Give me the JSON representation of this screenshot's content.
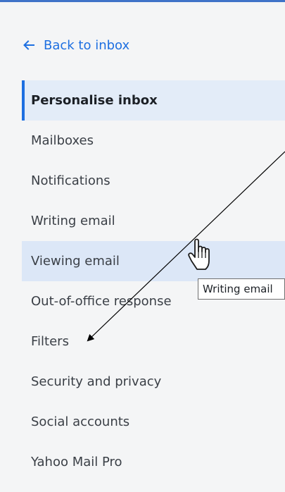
{
  "back_link": {
    "label": "Back to inbox",
    "icon": "left-arrow-icon"
  },
  "menu": {
    "items": [
      {
        "label": "Personalise inbox",
        "state": "selected"
      },
      {
        "label": "Mailboxes"
      },
      {
        "label": "Notifications"
      },
      {
        "label": "Writing email"
      },
      {
        "label": "Viewing email",
        "state": "hover"
      },
      {
        "label": "Out-of-office response"
      },
      {
        "label": "Filters"
      },
      {
        "label": "Security and privacy"
      },
      {
        "label": "Social accounts"
      },
      {
        "label": "Yahoo Mail Pro"
      }
    ]
  },
  "tooltip": {
    "text": "Writing email"
  },
  "cursor": {
    "icon": "hand-pointer-icon"
  },
  "annotation": {
    "icon": "annotation-arrow-icon"
  },
  "colors": {
    "accent": "#1d6fe1",
    "top_bar": "#3f73c8",
    "background": "#f4f5f6",
    "selected_bg": "#e3ecf8",
    "hover_bg": "#dce7f7",
    "text": "#3a3f46"
  }
}
